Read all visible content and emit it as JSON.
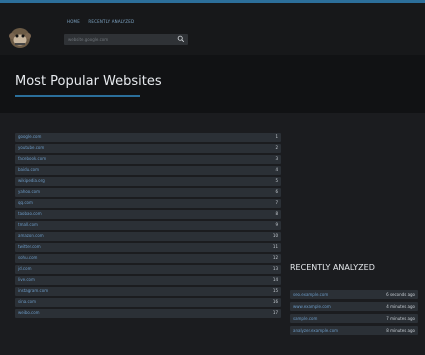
{
  "header": {
    "nav": [
      "HOME",
      "RECENTLY ANALYZED"
    ],
    "search": {
      "placeholder": "website.google.com"
    }
  },
  "page_title": "Most Popular Websites",
  "popular": [
    {
      "name": "google.com",
      "rank": "1"
    },
    {
      "name": "youtube.com",
      "rank": "2"
    },
    {
      "name": "facebook.com",
      "rank": "3"
    },
    {
      "name": "baidu.com",
      "rank": "4"
    },
    {
      "name": "wikipedia.org",
      "rank": "5"
    },
    {
      "name": "yahoo.com",
      "rank": "6"
    },
    {
      "name": "qq.com",
      "rank": "7"
    },
    {
      "name": "taobao.com",
      "rank": "8"
    },
    {
      "name": "tmall.com",
      "rank": "9"
    },
    {
      "name": "amazon.com",
      "rank": "10"
    },
    {
      "name": "twitter.com",
      "rank": "11"
    },
    {
      "name": "sohu.com",
      "rank": "12"
    },
    {
      "name": "jd.com",
      "rank": "13"
    },
    {
      "name": "live.com",
      "rank": "14"
    },
    {
      "name": "instagram.com",
      "rank": "15"
    },
    {
      "name": "sina.com",
      "rank": "16"
    },
    {
      "name": "weibo.com",
      "rank": "17"
    }
  ],
  "recent": {
    "title": "RECENTLY ANALYZED",
    "items": [
      {
        "site": "seo.example.com",
        "time": "6 seconds ago"
      },
      {
        "site": "www.example.com",
        "time": "4 minutes ago"
      },
      {
        "site": "sample.com",
        "time": "7 minutes ago"
      },
      {
        "site": "analyzer.example.com",
        "time": "8 minutes ago"
      }
    ]
  },
  "colors": {
    "accent": "#2c6f9b",
    "link": "#6c9bc7",
    "row": "#2b3036"
  }
}
